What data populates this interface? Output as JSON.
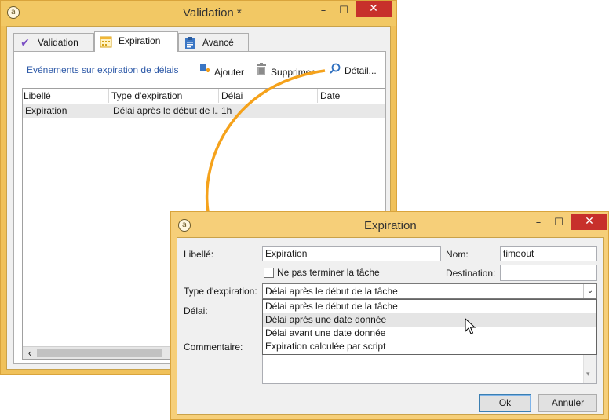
{
  "window_validation": {
    "title": "Validation *",
    "minimize_glyph": "–",
    "maximize_glyph": "☐",
    "close_glyph": "✕",
    "tabs": [
      {
        "label": "Validation",
        "icon": "check-icon",
        "active": false
      },
      {
        "label": "Expiration",
        "icon": "calendar-icon",
        "active": true
      },
      {
        "label": "Avancé",
        "icon": "clipboard-icon",
        "active": false
      }
    ],
    "toolbar": {
      "title": "Evénements sur expiration de délais",
      "add_label": "Ajouter",
      "delete_label": "Supprimer",
      "detail_label": "Détail..."
    },
    "grid": {
      "columns": [
        "Libellé",
        "Type d'expiration",
        "Délai",
        "Date"
      ],
      "rows": [
        [
          "Expiration",
          "Délai après le début de l...",
          "1h",
          ""
        ]
      ]
    },
    "scroll_left_glyph": "‹"
  },
  "window_expiration": {
    "title": "Expiration",
    "minimize_glyph": "–",
    "maximize_glyph": "☐",
    "close_glyph": "✕",
    "label_field": {
      "label": "Libellé:",
      "value": "Expiration"
    },
    "name_field": {
      "label": "Nom:",
      "value": "timeout"
    },
    "no_terminate": {
      "label": "Ne pas terminer la tâche",
      "checked": false
    },
    "destination_field": {
      "label": "Destination:",
      "value": ""
    },
    "expiration_type": {
      "label": "Type d'expiration:",
      "selected": "Délai après le début de la tâche",
      "arrow_glyph": "⌄",
      "options": [
        "Délai après le début de la tâche",
        "Délai après une date donnée",
        "Délai avant une date donnée",
        "Expiration calculée par script"
      ],
      "hovered_index": 1
    },
    "delay_label": "Délai:",
    "comment_label": "Commentaire:",
    "ok_label": "Ok",
    "cancel_label": "Annuler"
  },
  "colors": {
    "window_frame": "#f0c15a",
    "close_button": "#c7302b",
    "annotation_arrow": "#f5a21b",
    "toolbar_title": "#2e5aa8"
  }
}
